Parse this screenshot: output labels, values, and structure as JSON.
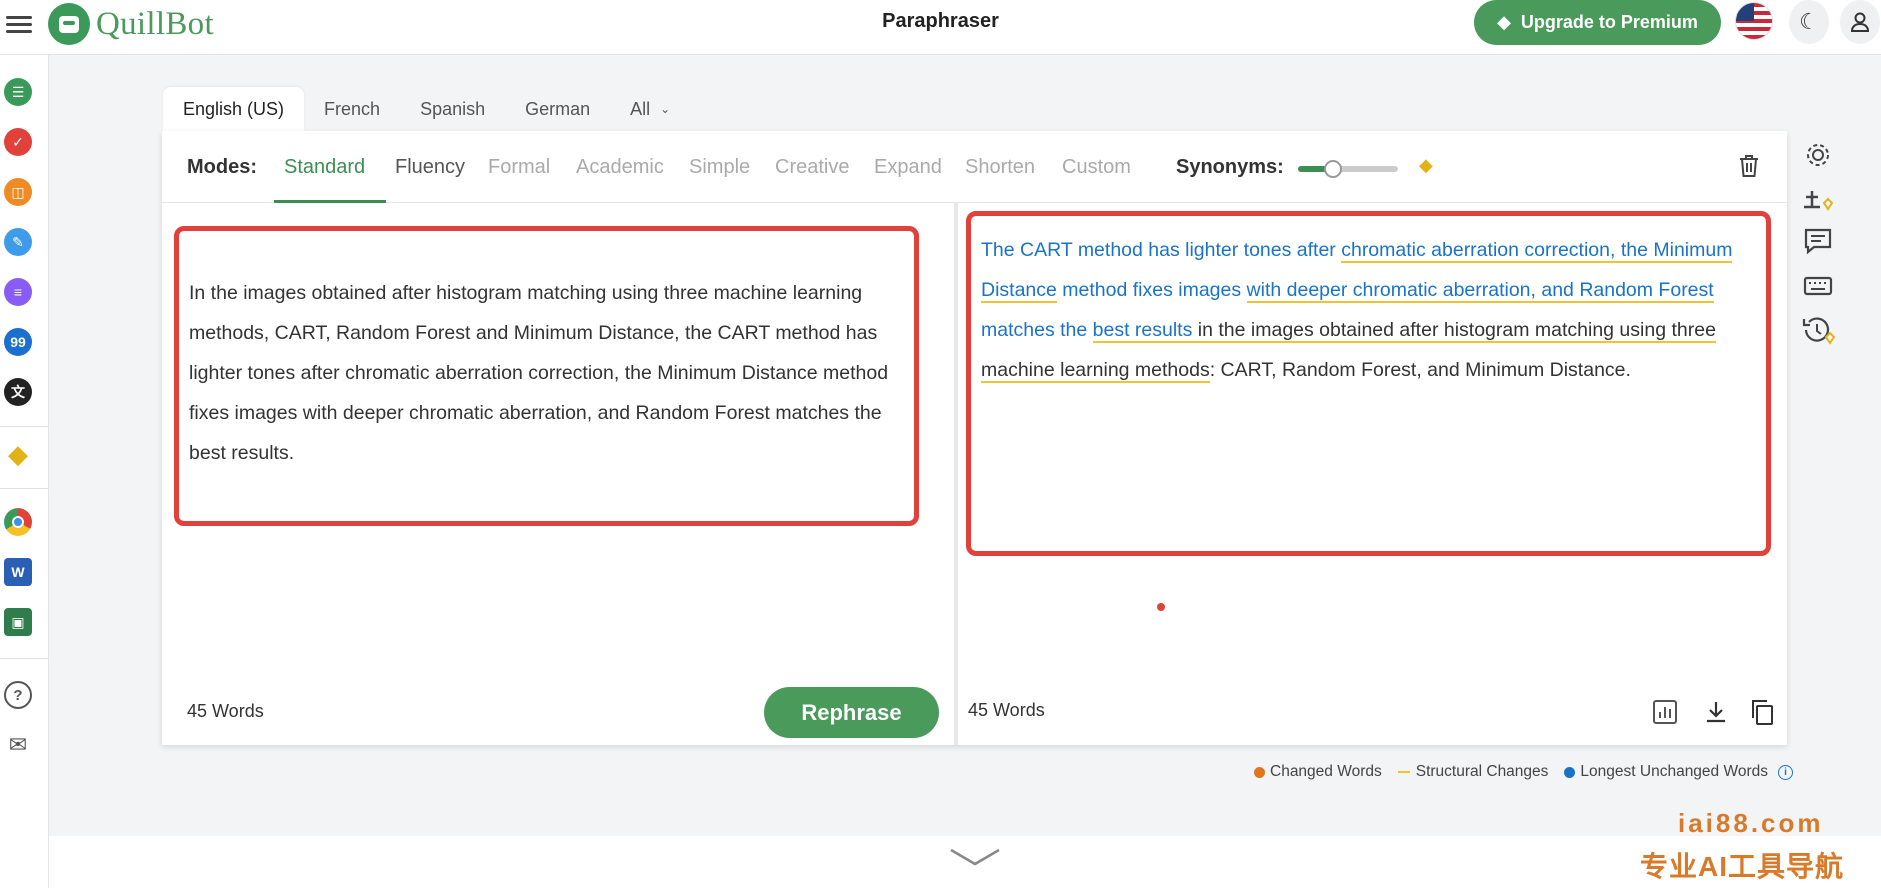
{
  "header": {
    "brand": "QuillBot",
    "title": "Paraphraser",
    "upgrade_label": "Upgrade to Premium"
  },
  "languages": [
    {
      "label": "English (US)",
      "active": true
    },
    {
      "label": "French"
    },
    {
      "label": "Spanish"
    },
    {
      "label": "German"
    },
    {
      "label": "All"
    }
  ],
  "modes": {
    "label": "Modes:",
    "items": [
      "Standard",
      "Fluency",
      "Formal",
      "Academic",
      "Simple",
      "Creative",
      "Expand",
      "Shorten",
      "Custom"
    ],
    "active": "Standard",
    "synonyms_label": "Synonyms:",
    "synonyms_level": 0.35
  },
  "input": {
    "text": "In the images obtained after histogram matching using three machine learning methods, CART, Random Forest and Minimum Distance, the CART method has lighter tones after chromatic aberration correction, the Minimum Distance method fixes images with deeper chromatic aberration, and Random Forest matches the best results.",
    "word_count": "45 Words",
    "rephrase_label": "Rephrase"
  },
  "output": {
    "segments": [
      {
        "text": "The CART method has lighter tones after ",
        "changed": true
      },
      {
        "text": "chromatic aberration correction, the Minimum Distance",
        "changed": true,
        "structural": true
      },
      {
        "text": " method fixes images ",
        "changed": true
      },
      {
        "text": "with deeper chromatic aberration, and Random Forest",
        "changed": true,
        "structural": true
      },
      {
        "text": " matches the ",
        "changed": true
      },
      {
        "text": "best results",
        "changed": true,
        "structural": true
      },
      {
        "text": " in the images obtained after histogram matching using three machine learning methods",
        "structural": true
      },
      {
        "text": ": CART, Random Forest, and Minimum Distance."
      }
    ],
    "word_count": "45 Words"
  },
  "legend": {
    "changed": "Changed Words",
    "structural": "Structural Changes",
    "unchanged": "Longest Unchanged Words"
  },
  "colors": {
    "brand_green": "#4a9a5b",
    "changed_blue": "#1a73c8",
    "structural_yellow": "#f1c232",
    "changed_orange": "#e0761f",
    "highlight_red": "#e0413b"
  },
  "watermark": {
    "line1": "iai88.com",
    "line2": "专业AI工具导航"
  }
}
